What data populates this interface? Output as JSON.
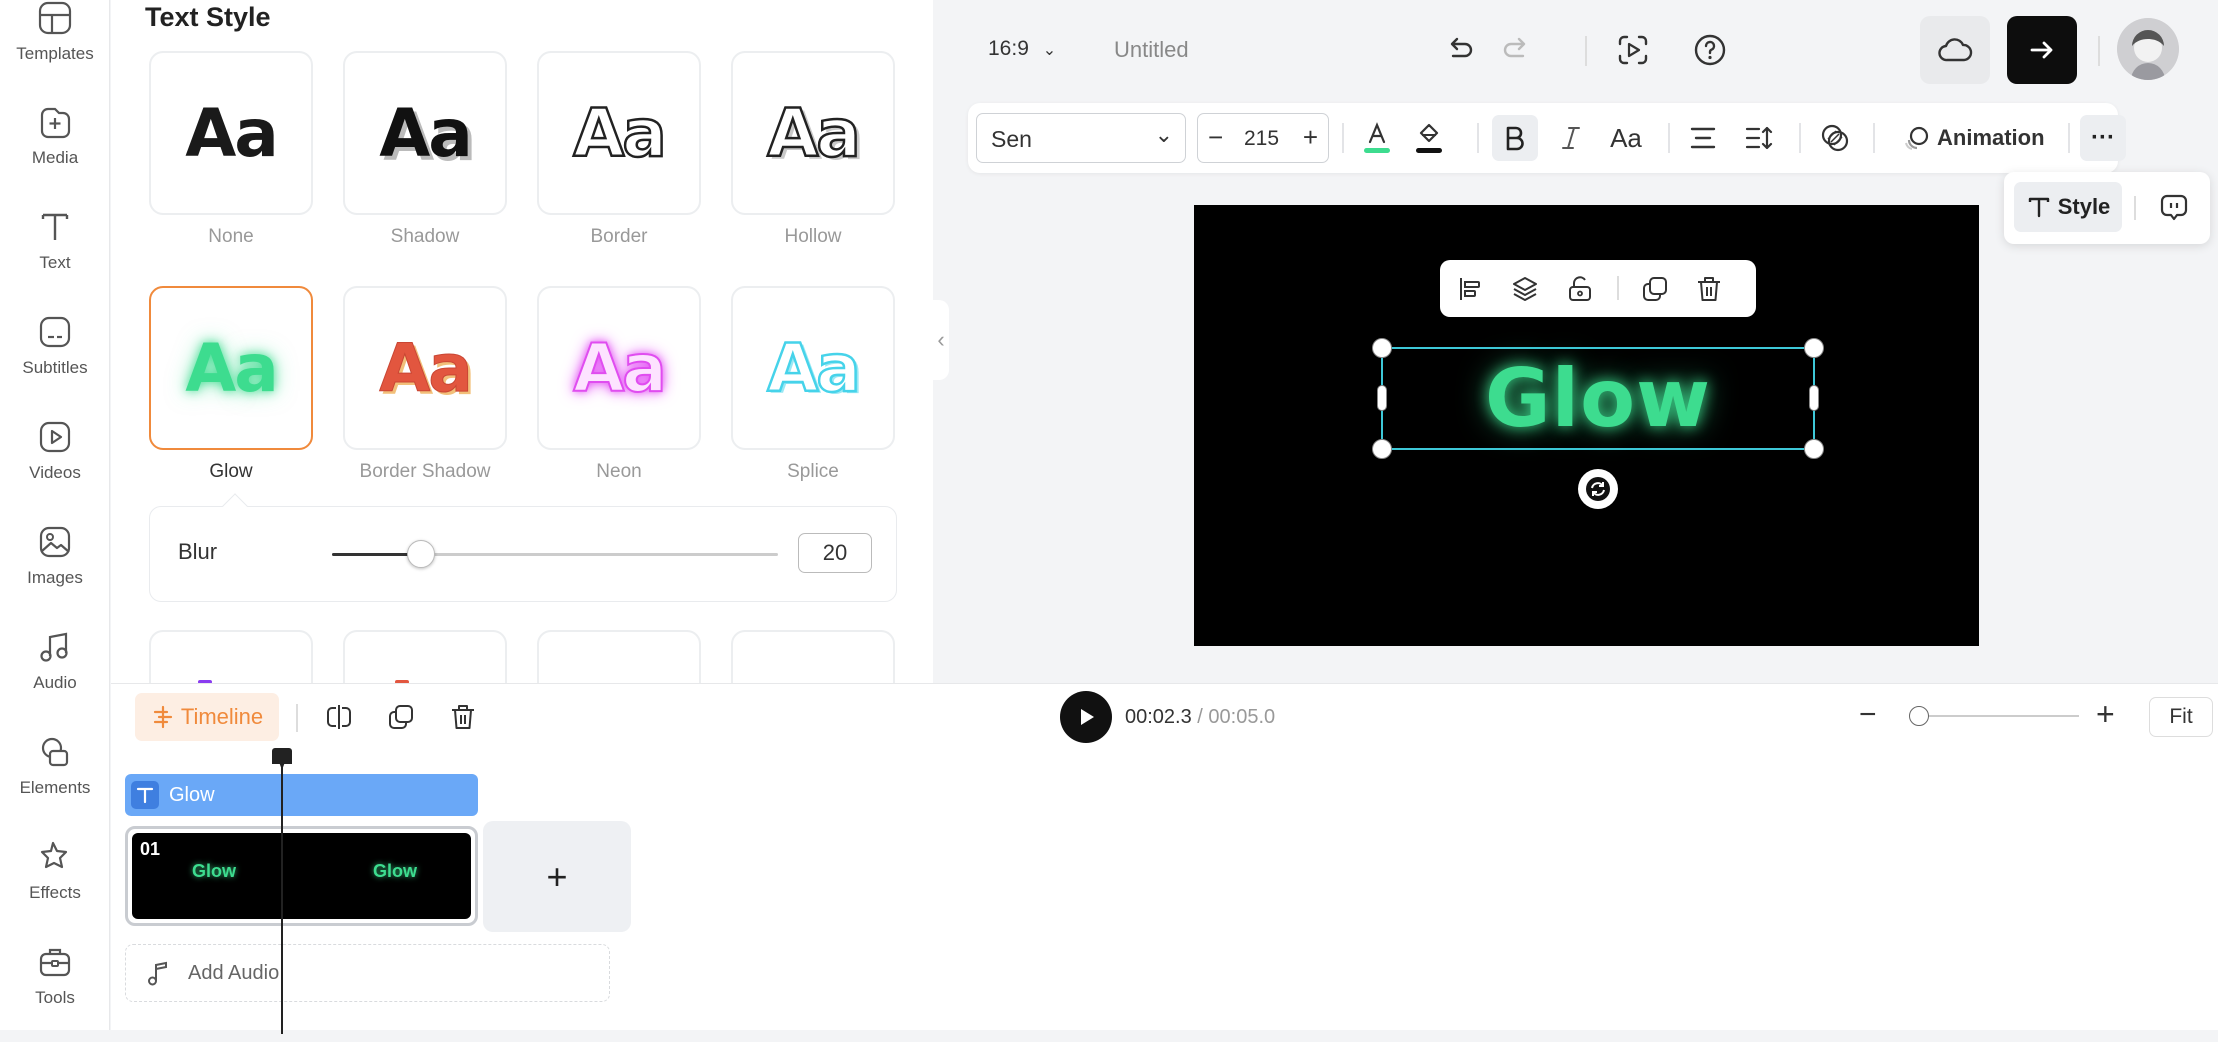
{
  "sidebar": {
    "items": [
      {
        "label": "Templates",
        "icon": "templates-icon"
      },
      {
        "label": "Media",
        "icon": "media-icon"
      },
      {
        "label": "Text",
        "icon": "text-icon"
      },
      {
        "label": "Subtitles",
        "icon": "subtitles-icon"
      },
      {
        "label": "Videos",
        "icon": "videos-icon"
      },
      {
        "label": "Images",
        "icon": "images-icon"
      },
      {
        "label": "Audio",
        "icon": "audio-icon"
      },
      {
        "label": "Elements",
        "icon": "elements-icon"
      },
      {
        "label": "Effects",
        "icon": "effects-icon"
      },
      {
        "label": "Tools",
        "icon": "tools-icon"
      }
    ]
  },
  "panel": {
    "title": "Text Style",
    "sample": "Aa",
    "styles": [
      {
        "label": "None",
        "color": "#1a1a1a"
      },
      {
        "label": "Shadow",
        "color": "#1a1a1a"
      },
      {
        "label": "Border",
        "color": "#ffffff"
      },
      {
        "label": "Hollow",
        "color": "#ffffff"
      },
      {
        "label": "Glow",
        "color": "#3ddc8f",
        "selected": true
      },
      {
        "label": "Border Shadow",
        "color": "#e2563f"
      },
      {
        "label": "Neon",
        "color": "#f28bf3"
      },
      {
        "label": "Splice",
        "color": "#7ee8f5"
      }
    ],
    "blur": {
      "label": "Blur",
      "value": "20",
      "fraction": 0.2
    }
  },
  "topbar": {
    "aspect_ratio": "16:9",
    "project_title": "Untitled"
  },
  "format": {
    "font": "Sen",
    "font_size": "215",
    "animation_label": "Animation"
  },
  "style_popover": {
    "style_label": "Style"
  },
  "canvas": {
    "text": "Glow",
    "text_color": "#3ddc8f"
  },
  "timeline": {
    "tab_label": "Timeline",
    "current_time": "00:02.3",
    "separator": "/",
    "total_time": "00:05.0",
    "fit_label": "Fit",
    "zoom_fraction": 0.0,
    "text_clip_label": "Glow",
    "scene_number": "01",
    "scene_thumb_text": "Glow",
    "add_audio_label": "Add Audio",
    "add_scene_symbol": "+"
  },
  "colors": {
    "accent": "#f08a3c",
    "glow": "#3ddc8f",
    "clip_blue": "#6aa8f7"
  }
}
